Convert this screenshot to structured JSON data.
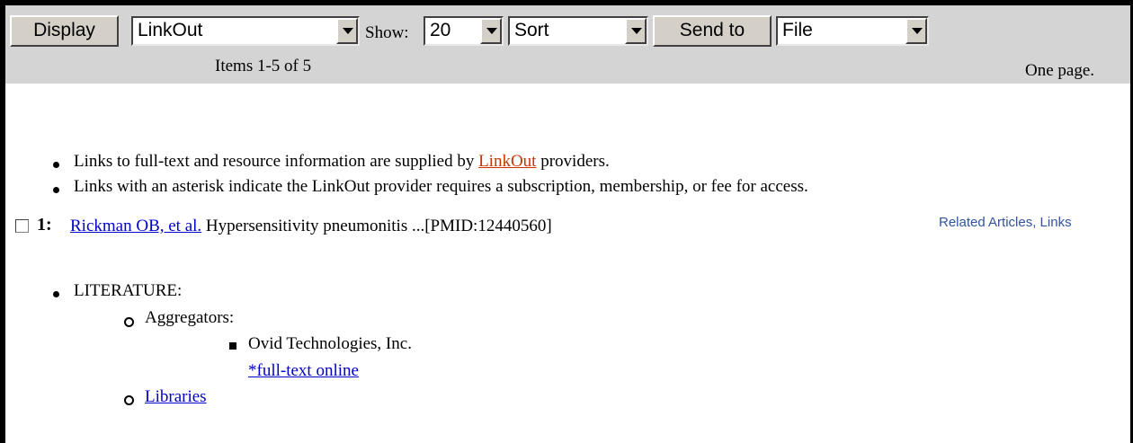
{
  "toolbar": {
    "display_label": "Display",
    "format_value": "LinkOut",
    "show_label": "Show:",
    "show_value": "20",
    "sort_value": "Sort",
    "send_to_label": "Send to",
    "destination_value": "File",
    "items_count": "Items 1-5 of 5",
    "pages_text": "One page."
  },
  "notes": {
    "line1_before": "Links to full-text and resource information are supplied by ",
    "line1_link": "LinkOut",
    "line1_after": " providers.",
    "line2": "Links with an asterisk indicate the LinkOut provider requires a subscription, membership, or fee for access."
  },
  "record": {
    "number": "1:",
    "authors": "Rickman OB, et al.",
    "title": " Hypersensitivity pneumonitis ...[PMID:12440560]",
    "related_links": "Related Articles, Links"
  },
  "linkout": {
    "category": "LITERATURE:",
    "aggregators_label": "Aggregators:",
    "provider": "Ovid Technologies, Inc.",
    "provider_link": "*full-text online",
    "libraries_link": "Libraries"
  },
  "colors": {
    "toolbar_bg": "#d4d4d4",
    "link_blue": "#0000cc",
    "link_red": "#cc3300",
    "related_links": "#335599"
  }
}
